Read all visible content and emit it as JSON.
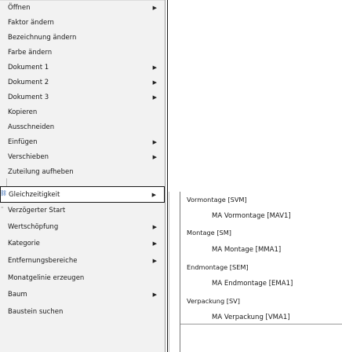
{
  "context_menu": {
    "items": [
      {
        "label": "Öffnen",
        "submenu": true
      },
      {
        "label": "Faktor ändern",
        "submenu": false
      },
      {
        "label": "Bezeichnung ändern",
        "submenu": false
      },
      {
        "label": "Farbe ändern",
        "submenu": false
      },
      {
        "label": "Dokument 1",
        "submenu": true
      },
      {
        "label": "Dokument 2",
        "submenu": true
      },
      {
        "label": "Dokument 3",
        "submenu": true
      },
      {
        "label": "Kopieren",
        "submenu": false
      },
      {
        "label": "Ausschneiden",
        "submenu": false
      },
      {
        "label": "Einfügen",
        "submenu": true
      },
      {
        "label": "Verschieben",
        "submenu": true
      },
      {
        "label": "Zuteilung aufheben",
        "submenu": false
      },
      {
        "label": "Gleichzeitigkeit",
        "submenu": true,
        "highlighted": true,
        "icon": "link-icon"
      },
      {
        "label": "Verzögerter Start",
        "submenu": false,
        "icon": "delay-icon"
      },
      {
        "label": "Wertschöpfung",
        "submenu": true
      },
      {
        "label": "Kategorie",
        "submenu": true
      },
      {
        "label": "Entfernungsbereiche",
        "submenu": true
      },
      {
        "label": "Monatgelinie erzeugen",
        "submenu": false
      },
      {
        "label": "Baum",
        "submenu": true
      },
      {
        "label": "Baustein suchen",
        "submenu": false
      }
    ]
  },
  "submenu": {
    "items": [
      {
        "label": "Vormontage [SVM]",
        "level": 1
      },
      {
        "label": "MA Vormontage [MAV1]",
        "level": 2
      },
      {
        "label": "Montage [SM]",
        "level": 1
      },
      {
        "label": "MA Montage [MMA1]",
        "level": 2
      },
      {
        "label": "Endmontage [SEM]",
        "level": 1
      },
      {
        "label": "MA Endmontage [EMA1]",
        "level": 2
      },
      {
        "label": "Verpackung [SV]",
        "level": 1
      },
      {
        "label": "MA Verpackung [VMA1]",
        "level": 2
      }
    ]
  },
  "colors": {
    "menu_background": "#f2f2f2",
    "highlight_border": "#1a1a1a",
    "icon_blue": "#3a6db5"
  }
}
